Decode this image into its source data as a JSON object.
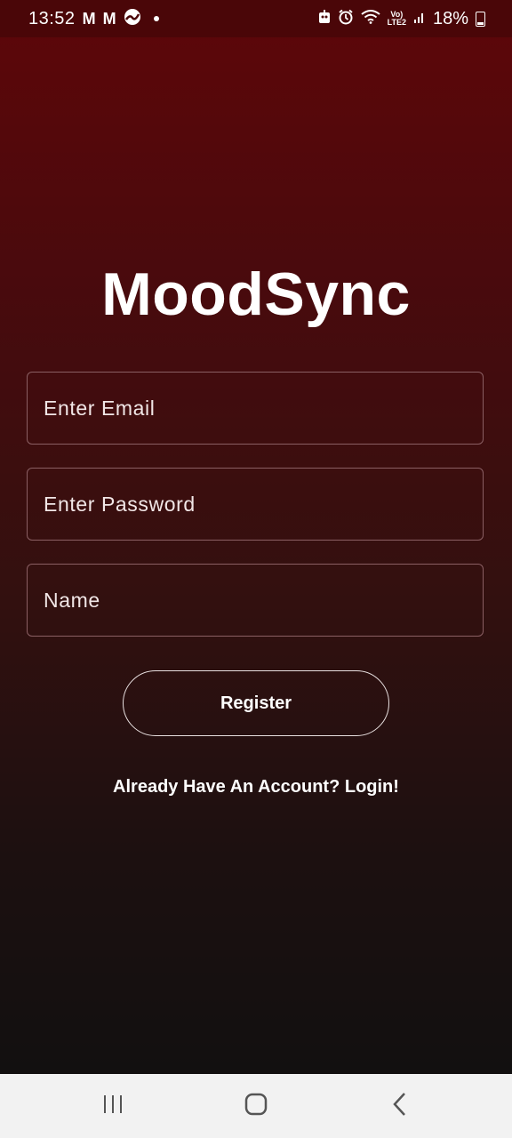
{
  "status_bar": {
    "time": "13:52",
    "battery": "18%",
    "volte_top": "Vo)",
    "volte_bottom": "LTE2"
  },
  "app": {
    "title": "MoodSync"
  },
  "form": {
    "email_placeholder": "Enter Email",
    "password_placeholder": "Enter Password",
    "name_placeholder": "Name",
    "register_label": "Register",
    "login_link": "Already Have An Account? Login!"
  },
  "colors": {
    "gradient_top": "#5e0609",
    "gradient_bottom": "#121010",
    "field_border": "#8a5f63",
    "nav_bar": "#f2f2f2"
  },
  "nav": {
    "icons": [
      "recent-apps-icon",
      "home-icon",
      "back-icon"
    ]
  }
}
